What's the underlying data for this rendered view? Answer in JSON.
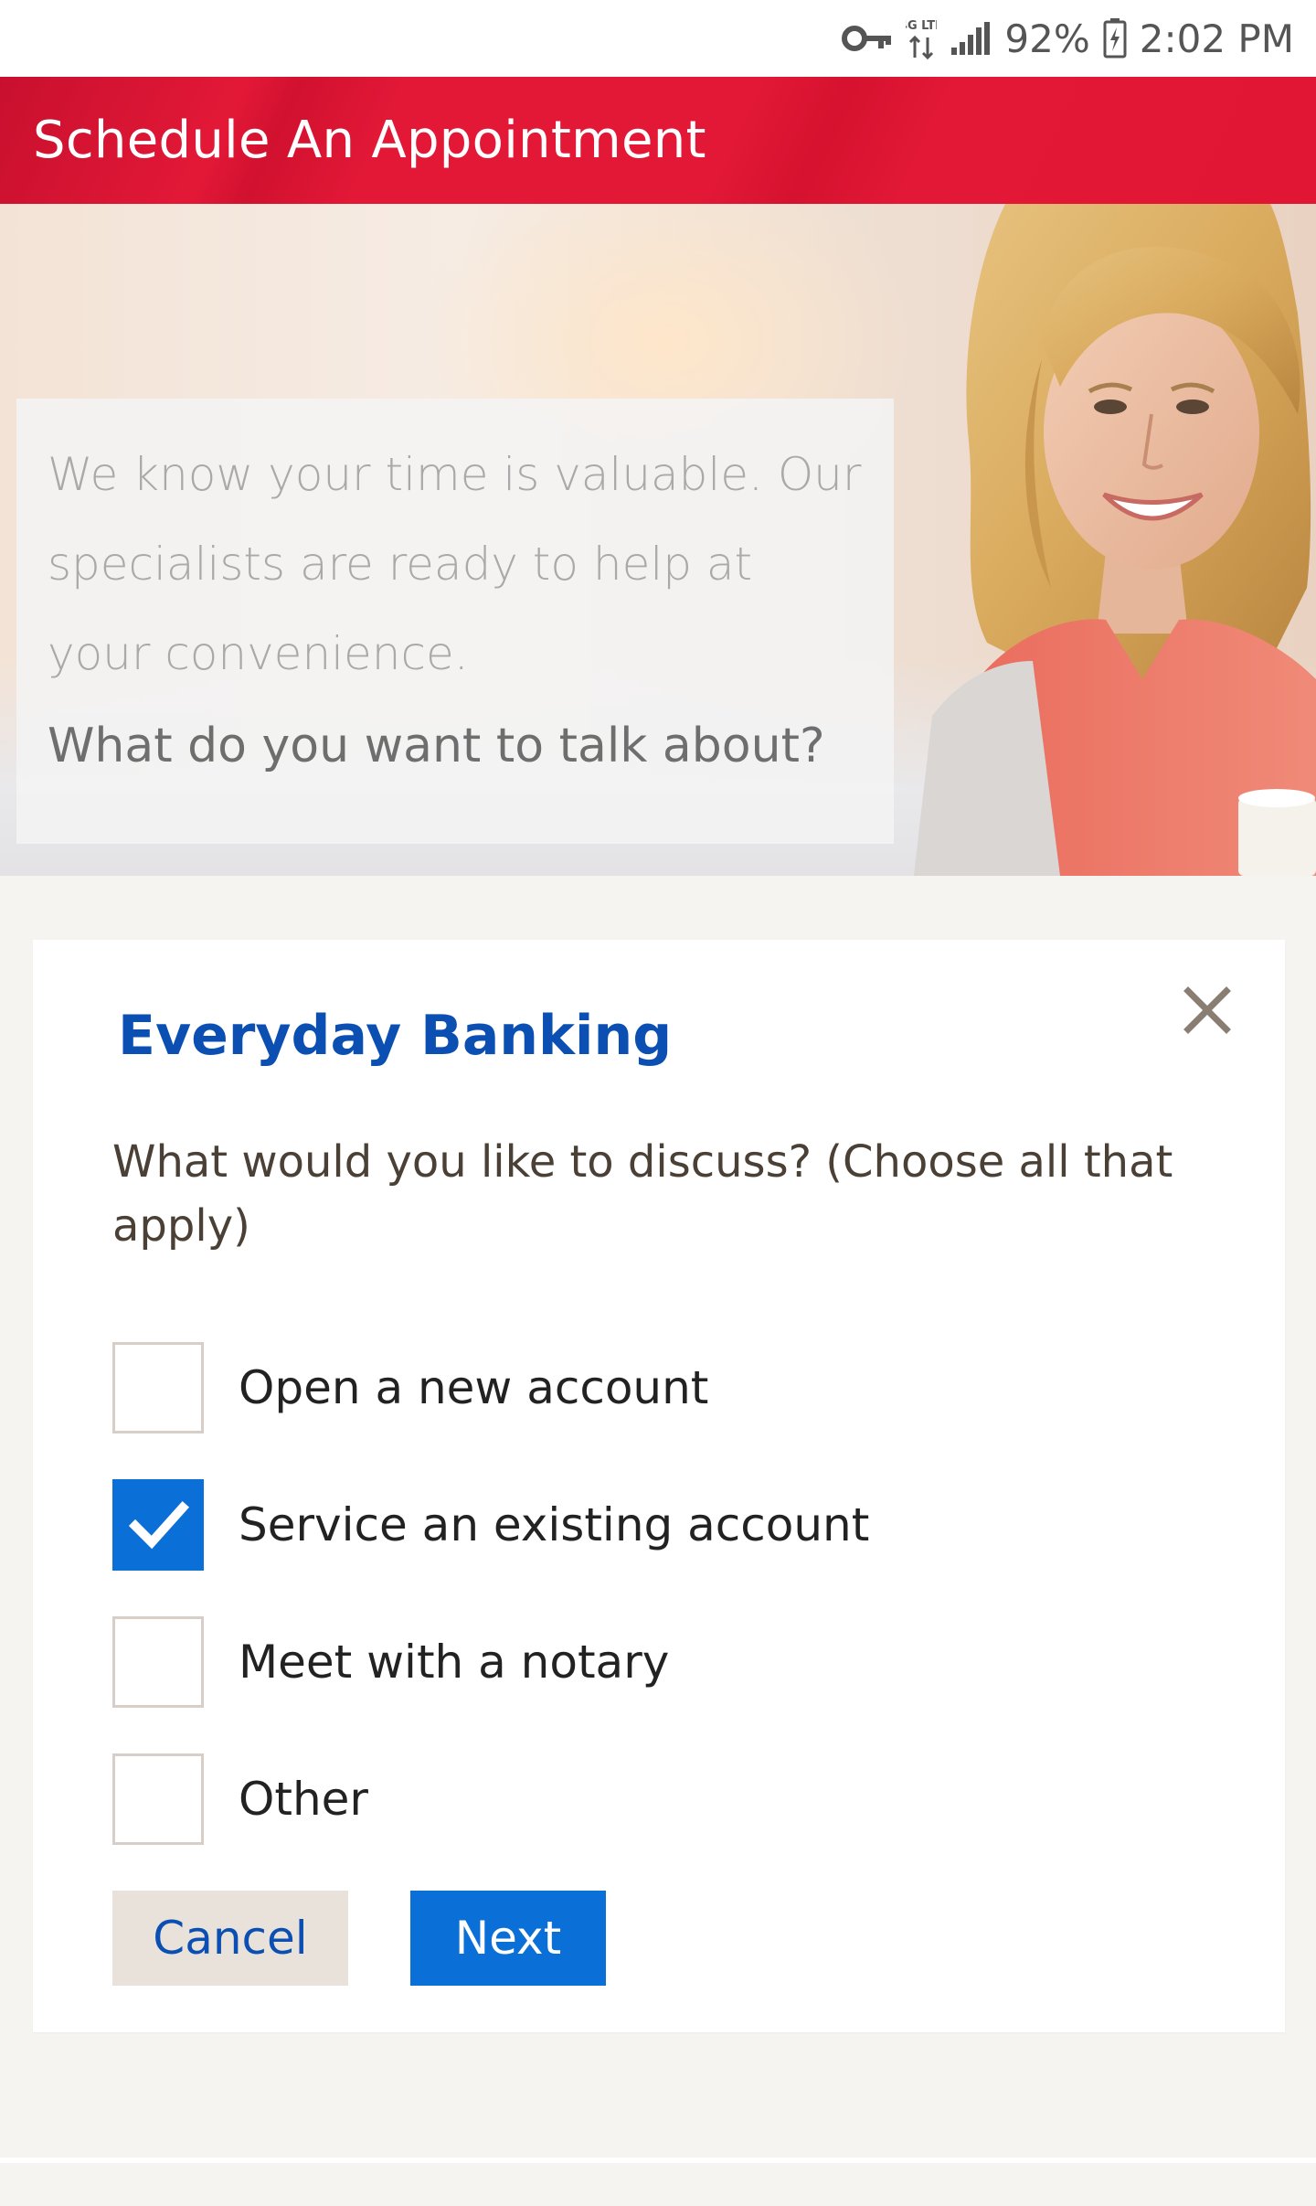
{
  "status_bar": {
    "icons": [
      "vpn-key-icon",
      "network-4g-lte-icon",
      "signal-icon",
      "battery-charging-icon"
    ],
    "network_label": "4G LTE",
    "battery": "92%",
    "time": "2:02 PM"
  },
  "header": {
    "title": "Schedule An Appointment",
    "color": "#e31837"
  },
  "hero": {
    "intro": "We know your time is valuable. Our specialists are ready to help at your convenience.",
    "prompt": "What do you want to talk about?"
  },
  "card": {
    "title": "Everyday Banking",
    "question": "What would you like to discuss? (Choose all that apply)",
    "options": [
      {
        "label": "Open a new account",
        "checked": false
      },
      {
        "label": "Service an existing account",
        "checked": true
      },
      {
        "label": "Meet with a notary",
        "checked": false
      },
      {
        "label": "Other",
        "checked": false
      }
    ],
    "cancel_label": "Cancel",
    "next_label": "Next"
  },
  "colors": {
    "brand_red": "#e31837",
    "primary_blue": "#0a6fd6",
    "title_blue": "#0b4fb3"
  }
}
